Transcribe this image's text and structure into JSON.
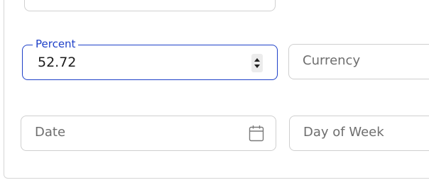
{
  "form": {
    "percent": {
      "label": "Percent",
      "value": "52.72"
    },
    "currency": {
      "placeholder": "Currency"
    },
    "date": {
      "placeholder": "Date",
      "icon": "calendar-icon"
    },
    "day_of_week": {
      "placeholder": "Day of Week"
    }
  },
  "colors": {
    "focus": "#1e40c8",
    "border": "#cfcfcf",
    "placeholder": "#6e6e6e"
  }
}
